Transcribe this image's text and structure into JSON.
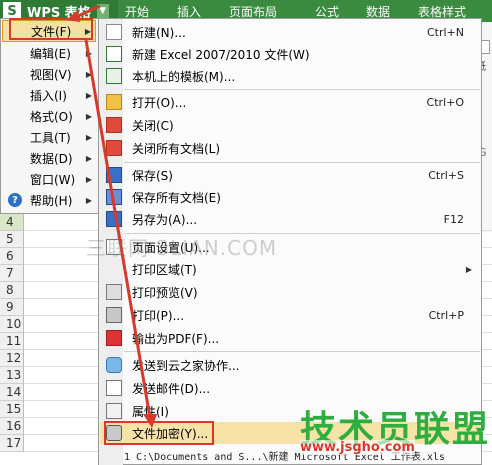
{
  "app": {
    "logo_letter": "S",
    "title": "WPS 表格",
    "dropdown": "▼"
  },
  "tabs": [
    "开始",
    "插入",
    "页面布局",
    "公式",
    "数据",
    "表格样式"
  ],
  "right_panel": {
    "text_a": "纸",
    "text_b": "G"
  },
  "main_menu": [
    {
      "label": "文件(F)",
      "arrow": "▶"
    },
    {
      "label": "编辑(E)",
      "arrow": "▶"
    },
    {
      "label": "视图(V)",
      "arrow": "▶"
    },
    {
      "label": "插入(I)",
      "arrow": "▶"
    },
    {
      "label": "格式(O)",
      "arrow": "▶"
    },
    {
      "label": "工具(T)",
      "arrow": "▶"
    },
    {
      "label": "数据(D)",
      "arrow": "▶"
    },
    {
      "label": "窗口(W)",
      "arrow": "▶"
    },
    {
      "label": "帮助(H)",
      "arrow": "▶"
    }
  ],
  "help_icon": "?",
  "file_menu": [
    {
      "label": "新建(N)...",
      "shortcut": "Ctrl+N",
      "icon": "new-doc-icon"
    },
    {
      "label": "新建 Excel 2007/2010 文件(W)",
      "shortcut": "",
      "icon": "new-excel-icon"
    },
    {
      "label": "本机上的模板(M)...",
      "shortcut": "",
      "icon": "template-icon"
    },
    {
      "label": "打开(O)...",
      "shortcut": "Ctrl+O",
      "icon": "open-folder-icon"
    },
    {
      "label": "关闭(C)",
      "shortcut": "",
      "icon": "close-doc-icon"
    },
    {
      "label": "关闭所有文档(L)",
      "shortcut": "",
      "icon": "close-all-icon"
    },
    {
      "label": "保存(S)",
      "shortcut": "Ctrl+S",
      "icon": "save-icon"
    },
    {
      "label": "保存所有文档(E)",
      "shortcut": "",
      "icon": "save-all-icon"
    },
    {
      "label": "另存为(A)...",
      "shortcut": "F12",
      "icon": "save-as-icon"
    },
    {
      "label": "页面设置(U)...",
      "shortcut": "",
      "icon": "page-setup-icon"
    },
    {
      "label": "打印区域(T)",
      "shortcut": "",
      "icon": "print-area-icon",
      "arrow": "▶"
    },
    {
      "label": "打印预览(V)",
      "shortcut": "",
      "icon": "print-preview-icon"
    },
    {
      "label": "打印(P)...",
      "shortcut": "Ctrl+P",
      "icon": "printer-icon"
    },
    {
      "label": "输出为PDF(F)...",
      "shortcut": "",
      "icon": "pdf-icon"
    },
    {
      "label": "发送到云之家协作...",
      "shortcut": "",
      "icon": "cloud-icon"
    },
    {
      "label": "发送邮件(D)...",
      "shortcut": "",
      "icon": "mail-icon"
    },
    {
      "label": "属性(I)",
      "shortcut": "",
      "icon": "properties-icon"
    },
    {
      "label": "文件加密(Y)...",
      "shortcut": "",
      "icon": "encrypt-lock-icon"
    }
  ],
  "recent_file": "1 C:\\Documents and S...\\新建 Microsoft Excel 工作表.xls",
  "row_numbers": [
    "4",
    "5",
    "6",
    "7",
    "8",
    "9",
    "10",
    "11",
    "12",
    "13",
    "14",
    "15",
    "16",
    "17"
  ],
  "watermarks": {
    "site_grey": "三联网 3LIAN.COM",
    "brand_green": "技术员联盟",
    "url_red": "www.jsgho.com"
  },
  "colors": {
    "wps_green": "#3a8a3f",
    "highlight_red": "#d63a2b",
    "hover_yellow": "#f5dfa3"
  }
}
